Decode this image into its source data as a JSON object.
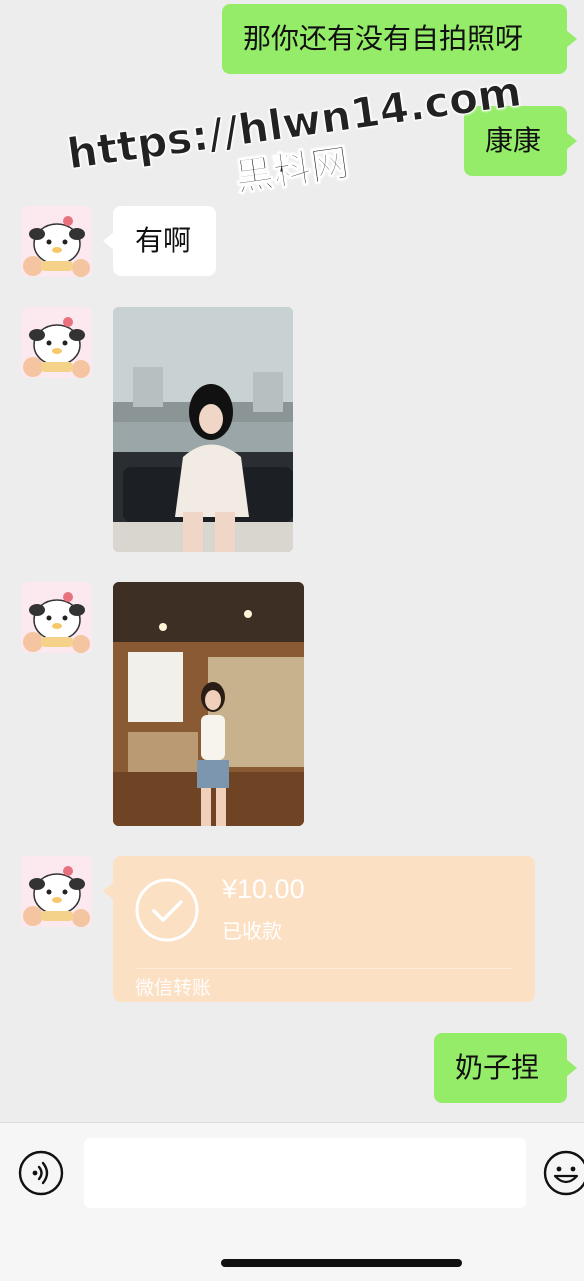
{
  "messages": {
    "out1": "那你还有没有自拍照呀",
    "out2": "康康",
    "in1": "有啊",
    "out3": "奶子捏"
  },
  "watermark": {
    "url": "https://hlwn14.com",
    "name": "黑料网"
  },
  "transfer": {
    "amount": "¥10.00",
    "status": "已收款",
    "type": "微信转账"
  },
  "input": {
    "value": "",
    "placeholder": ""
  },
  "icons": {
    "voice": "voice-icon",
    "emoji": "emoji-icon",
    "check": "check-circle-icon"
  },
  "colors": {
    "background": "#ededed",
    "outgoing_bubble": "#95ec69",
    "incoming_bubble": "#ffffff",
    "transfer_card": "#fce0c4"
  }
}
